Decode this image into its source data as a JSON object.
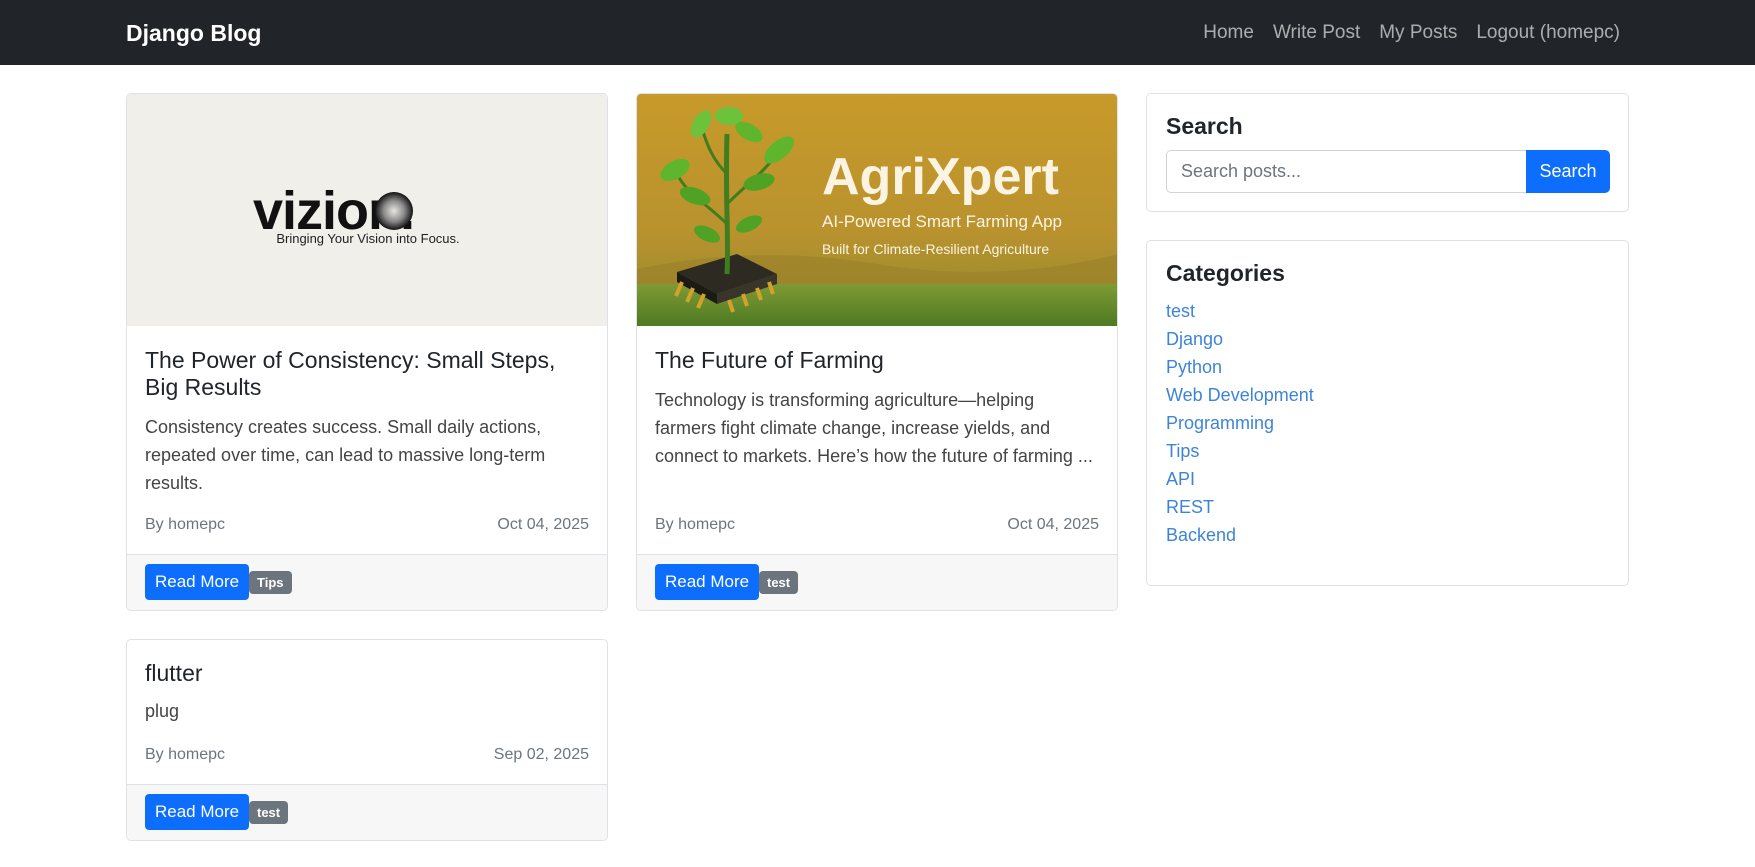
{
  "navbar": {
    "brand": "Django Blog",
    "links": [
      "Home",
      "Write Post",
      "My Posts",
      "Logout (homepc)"
    ]
  },
  "posts": [
    {
      "image": {
        "wordmark": "vizion.",
        "tagline": "Bringing Your Vision into Focus."
      },
      "title": "The Power of Consistency: Small Steps, Big Results",
      "excerpt": "Consistency creates success. Small daily actions, repeated over time, can lead to massive long-term results.",
      "author": "By homepc",
      "date": "Oct 04, 2025",
      "read_more": "Read More",
      "category": "Tips"
    },
    {
      "image": {
        "title": "AgriXpert",
        "subtitle": "AI-Powered Smart Farming App",
        "tagline": "Built for Climate-Resilient Agriculture"
      },
      "title": "The Future of Farming",
      "excerpt": "Technology is transforming agriculture—helping farmers fight climate change, increase yields, and connect to markets. Here’s how the future of farming ...",
      "author": "By homepc",
      "date": "Oct 04, 2025",
      "read_more": "Read More",
      "category": "test"
    },
    {
      "title": "flutter",
      "excerpt": "plug",
      "author": "By homepc",
      "date": "Sep 02, 2025",
      "read_more": "Read More",
      "category": "test"
    }
  ],
  "sidebar": {
    "search": {
      "title": "Search",
      "placeholder": "Search posts...",
      "button": "Search"
    },
    "categories": {
      "title": "Categories",
      "items": [
        "test",
        "Django",
        "Python",
        "Web Development",
        "Programming",
        "Tips",
        "API",
        "REST",
        "Backend"
      ]
    }
  },
  "colors": {
    "navbar_bg": "#212529",
    "primary": "#0d6efd",
    "badge": "#6c757d",
    "link": "#3d84d8"
  }
}
